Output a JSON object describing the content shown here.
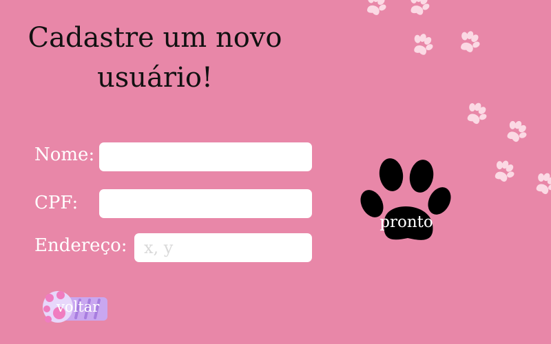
{
  "header": {
    "title": "Cadastre um novo usuário!"
  },
  "form": {
    "name_label": "Nome:",
    "name_value": "",
    "cpf_label": "CPF:",
    "cpf_value": "",
    "address_label": "Endereço:",
    "address_placeholder": "x, y",
    "address_value": ""
  },
  "actions": {
    "submit_label": "pronto",
    "back_label": "voltar"
  },
  "theme": {
    "background": "#e887a8",
    "paw_light": "#fbd9e4",
    "paw_dark": "#000000",
    "back_button": "#c9a7f0"
  }
}
